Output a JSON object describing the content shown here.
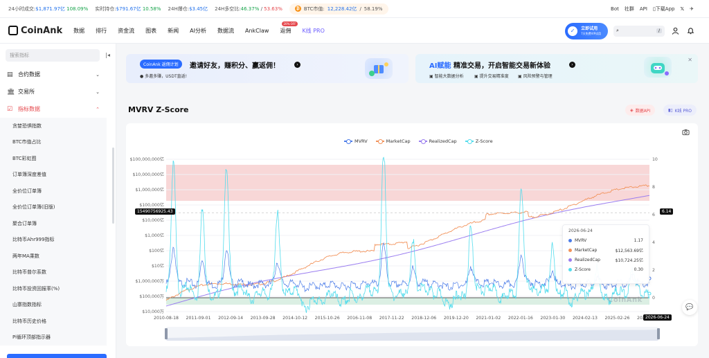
{
  "ticker": {
    "items": [
      {
        "label": "24小时成交:",
        "value": "$1,871.97亿",
        "change": "108.09%",
        "change_dir": "up"
      },
      {
        "label": "实时持仓:",
        "value": "$791.67亿",
        "change": "10.58%",
        "change_dir": "up"
      },
      {
        "label": "24H爆仓:",
        "value": "$3.45亿",
        "change": "",
        "change_dir": "none"
      },
      {
        "label": "24H多空比:",
        "value": "46.37%",
        "change": "53.63%",
        "change_dir": "split"
      }
    ],
    "btc": {
      "icon": "bitcoin-icon",
      "label": "BTC市值:",
      "value": "12,228.42亿",
      "change": "58.19%"
    },
    "right_links": [
      "Bot",
      "社群",
      "API",
      "下载App"
    ]
  },
  "nav": {
    "brand": "CoinAnk",
    "items": [
      "数据",
      "排行",
      "资金流",
      "图表",
      "新闻",
      "AI分析",
      "数据流",
      "AnkClaw",
      "返佣",
      "K线 PRO"
    ],
    "hot_badge": "20% OFF",
    "trial_title": "立即试用",
    "trial_sub": "7天免费VIP试用",
    "search_key": "/"
  },
  "sidebar": {
    "search_placeholder": "搜索指标",
    "groups": [
      {
        "label": "合约数据",
        "icon": "contract-icon",
        "expanded": false
      },
      {
        "label": "交易所",
        "icon": "exchange-icon",
        "expanded": false
      },
      {
        "label": "指标数据",
        "icon": "indicator-icon",
        "expanded": true
      }
    ],
    "sub_items": [
      "贪婪恐惧指数",
      "BTC市值占比",
      "BTC彩虹图",
      "订单簿深度差值",
      "全价位订单簿",
      "全价位订单簿(旧版)",
      "聚合订单簿",
      "比特币Ahr999指标",
      "两年MA乘数",
      "比特币普尔系数",
      "比特币投资回报率(%)",
      "山寨指数指标",
      "比特币历史价格",
      "Pi循环顶部指示器"
    ]
  },
  "banners": {
    "left": {
      "tag": "CoinAnk 返佣计划",
      "title": "邀请好友，赚积分、赢返佣！",
      "sub": "多邀多赚，USDT直返!"
    },
    "right": {
      "title_accent": "AI赋能",
      "title": "精准交易，开启智能交易新体验",
      "features": [
        "智能大数据分析",
        "提升交易精准度",
        "风险预警与管理"
      ]
    }
  },
  "chart_header": {
    "title": "MVRV Z-Score",
    "api_label": "数据API",
    "kline_label": "K线 PRO"
  },
  "chart_data": {
    "type": "line",
    "series": [
      {
        "name": "MVRV",
        "color": "#4a7be8",
        "axis": "right"
      },
      {
        "name": "MarketCap",
        "color": "#f2925a",
        "axis": "left"
      },
      {
        "name": "RealizedCap",
        "color": "#9a7df0",
        "axis": "left"
      },
      {
        "name": "Z-Score",
        "color": "#52dced",
        "axis": "right"
      }
    ],
    "x_ticks": [
      "2010-08-18",
      "2011-09-01",
      "2012-09-14",
      "2013-09-28",
      "2014-10-12",
      "2015-10-26",
      "2016-11-08",
      "2017-11-22",
      "2018-12-06",
      "2019-12-20",
      "2021-01-02",
      "2022-01-16",
      "2023-01-30",
      "2024-02-13",
      "2025-02-26",
      "2026-06-24"
    ],
    "y_left_ticks": [
      "$100,000,000亿",
      "$10,000,000亿",
      "$1,000,000亿",
      "$100,000亿",
      "$10,000亿",
      "$1,000亿",
      "$100亿",
      "$10亿",
      "$1,000,000万",
      "$100,000万",
      "$10,000万"
    ],
    "y_right_ticks": [
      "10",
      "8",
      "6",
      "4",
      "2",
      "0"
    ],
    "y_right_range": [
      -1,
      10
    ],
    "log_scale_left": true,
    "bands": [
      {
        "label": "overvalued zone",
        "from": 7,
        "to": 9.6,
        "color": "#f6c9c9"
      },
      {
        "label": "undervalued zone",
        "from": -0.5,
        "to": 0,
        "color": "#cfe9d9"
      }
    ],
    "left_marker": "15490756925.43",
    "right_marker": "6.14",
    "cursor_date": "2026-06-24",
    "tooltip": {
      "date": "2026-06-24",
      "rows": [
        {
          "name": "MVRV",
          "value": "1.17"
        },
        {
          "name": "MarketCap",
          "value": "$12,563.69亿"
        },
        {
          "name": "RealizedCap",
          "value": "$10,724.25亿"
        },
        {
          "name": "Z-Score",
          "value": "0.30"
        }
      ]
    },
    "watermark": "CoinAnk"
  }
}
